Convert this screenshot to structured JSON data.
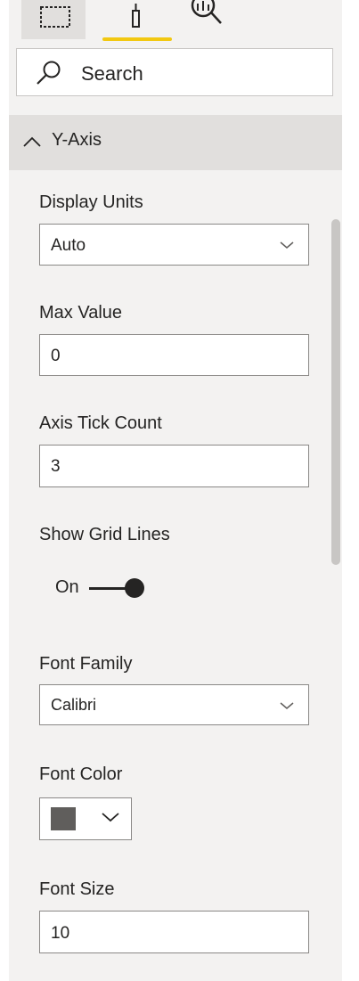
{
  "search": {
    "label": "Search"
  },
  "section": {
    "title": "Y-Axis"
  },
  "display_units": {
    "label": "Display Units",
    "value": "Auto"
  },
  "max_value": {
    "label": "Max Value",
    "value": "0"
  },
  "axis_tick_count": {
    "label": "Axis Tick Count",
    "value": "3"
  },
  "grid_lines": {
    "label": "Show Grid Lines",
    "state": "On"
  },
  "font_family": {
    "label": "Font Family",
    "value": "Calibri"
  },
  "font_color": {
    "label": "Font Color",
    "swatch": "#605e5c"
  },
  "font_size": {
    "label": "Font Size",
    "value": "10"
  },
  "colors": {
    "accent": "#f2c811"
  }
}
